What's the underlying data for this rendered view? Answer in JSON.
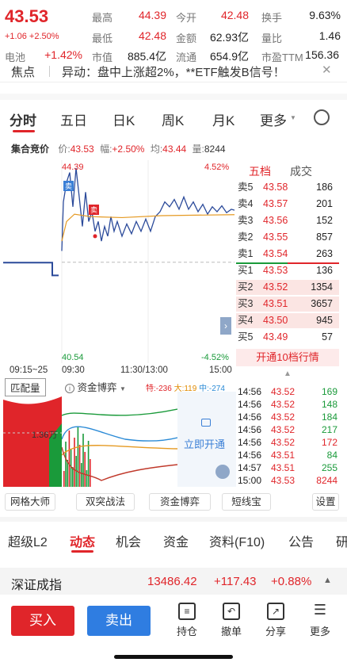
{
  "quote": {
    "price": "43.53",
    "change": "+1.06",
    "change_pct": "+2.50%",
    "rows": [
      [
        {
          "label": "最高",
          "value": "44.39",
          "color": "red"
        },
        {
          "label": "今开",
          "value": "42.48",
          "color": "red"
        },
        {
          "label": "换手",
          "value": "9.63%",
          "color": "normal"
        }
      ],
      [
        {
          "label": "最低",
          "value": "42.48",
          "color": "red"
        },
        {
          "label": "金额",
          "value": "62.93亿",
          "color": "normal"
        },
        {
          "label": "量比",
          "value": "1.46",
          "color": "normal"
        }
      ],
      [
        {
          "label": "电池",
          "value": "+1.42%",
          "color": "red"
        },
        {
          "label": "市值",
          "value": "885.4亿",
          "color": "normal"
        },
        {
          "label": "流通",
          "value": "654.9亿",
          "color": "normal"
        },
        {
          "label": "市盈TTM",
          "value": "156.36",
          "color": "normal"
        }
      ]
    ]
  },
  "news": {
    "tag": "焦点",
    "text": "异动：盘中上涨超2%，**ETF触发B信号！",
    "close": "✕"
  },
  "tabs": [
    "分时",
    "五日",
    "日K",
    "周K",
    "月K",
    "更多"
  ],
  "auction": {
    "title": "集合竞价",
    "price_label": "价:",
    "price": "43.53",
    "pct_label": "幅:",
    "pct": "+2.50%",
    "avg_label": "均:",
    "avg": "43.44",
    "vol_label": "量:",
    "vol": "8244"
  },
  "chart": {
    "high_price": "44.39",
    "low_price": "40.54",
    "high_pct": "4.52%",
    "low_pct": "-4.52%",
    "marker_sell": "卖",
    "marker_sell2": "卖",
    "time_labels": [
      "09:15~25",
      "09:30",
      "11:30/13:00",
      "15:00"
    ],
    "ylim": [
      40.54,
      44.39
    ],
    "prev_close": 42.47
  },
  "orderbook": {
    "tabs": [
      "五档",
      "成交"
    ],
    "asks": [
      {
        "label": "卖5",
        "price": "43.58",
        "vol": "186"
      },
      {
        "label": "卖4",
        "price": "43.57",
        "vol": "201"
      },
      {
        "label": "卖3",
        "price": "43.56",
        "vol": "152"
      },
      {
        "label": "卖2",
        "price": "43.55",
        "vol": "857"
      },
      {
        "label": "卖1",
        "price": "43.54",
        "vol": "263"
      }
    ],
    "bids": [
      {
        "label": "买1",
        "price": "43.53",
        "vol": "136"
      },
      {
        "label": "买2",
        "price": "43.52",
        "vol": "1354"
      },
      {
        "label": "买3",
        "price": "43.51",
        "vol": "3657"
      },
      {
        "label": "买4",
        "price": "43.50",
        "vol": "945"
      },
      {
        "label": "买5",
        "price": "43.49",
        "vol": "57"
      }
    ],
    "open_l10": "开通10档行情"
  },
  "trades": [
    {
      "t": "14:56",
      "p": "43.52",
      "v": "169",
      "c": "green"
    },
    {
      "t": "14:56",
      "p": "43.52",
      "v": "148",
      "c": "green"
    },
    {
      "t": "14:56",
      "p": "43.52",
      "v": "184",
      "c": "green"
    },
    {
      "t": "14:56",
      "p": "43.52",
      "v": "217",
      "c": "green"
    },
    {
      "t": "14:56",
      "p": "43.52",
      "v": "172",
      "c": "red"
    },
    {
      "t": "14:56",
      "p": "43.51",
      "v": "84",
      "c": "green"
    },
    {
      "t": "14:57",
      "p": "43.51",
      "v": "255",
      "c": "green"
    },
    {
      "t": "15:00",
      "p": "43.53",
      "v": "8244",
      "c": "red"
    }
  ],
  "lower": {
    "match_tab": "匹配量",
    "flow_tab": "资金博弈",
    "special": "特:-236",
    "large": "大:119",
    "medium": "中:-274",
    "vol_label": "1.36万",
    "unlock": "立即开通"
  },
  "tools": [
    "网格大师",
    "双突战法",
    "资金博弈",
    "短线宝",
    "设置"
  ],
  "bottom_tabs": [
    "超级L2",
    "动态",
    "机会",
    "资金",
    "资料(F10)",
    "公告",
    "研"
  ],
  "index": {
    "name": "深证成指",
    "value": "13486.42",
    "change": "+117.43",
    "pct": "+0.88%"
  },
  "actions": {
    "buy": "买入",
    "sell": "卖出",
    "hold": "持仓",
    "cancel": "撤单",
    "share": "分享",
    "more": "更多"
  }
}
